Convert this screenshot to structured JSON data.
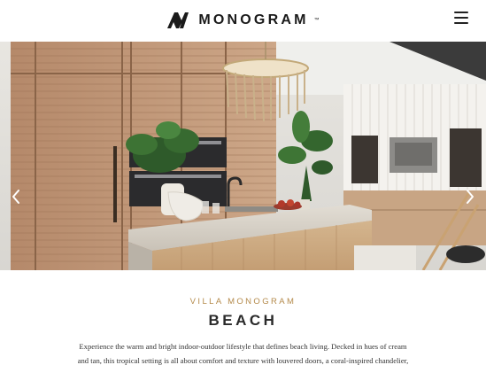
{
  "header": {
    "brand": "MONOGRAM",
    "trademark": "™",
    "logo_icon": "monogram-m-logo",
    "menu_icon": "hamburger-icon"
  },
  "hero": {
    "prev_icon": "chevron-left-icon",
    "next_icon": "chevron-right-icon"
  },
  "content": {
    "eyebrow": "VILLA MONOGRAM",
    "title": "BEACH",
    "description": "Experience the warm and bright indoor-outdoor lifestyle that defines beach living. Decked in hues of cream and tan, this tropical setting is all about comfort and texture with louvered doors, a coral-inspired chandelier, and a large, lux rattan island with a mirrored stainless base. The Minimalist Collection's clean design –"
  },
  "colors": {
    "accent_gold": "#b48a4b",
    "text_dark": "#2a2a2a"
  }
}
